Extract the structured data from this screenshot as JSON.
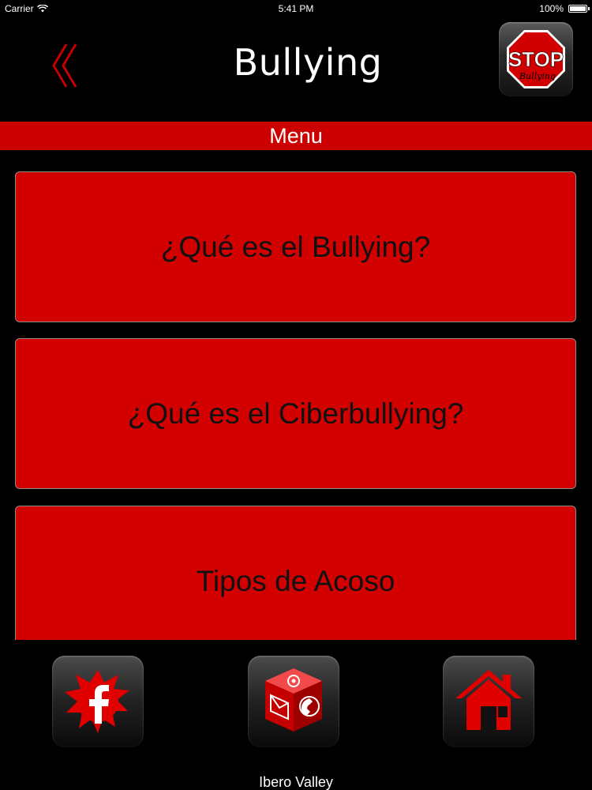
{
  "status_bar": {
    "carrier": "Carrier",
    "time": "5:41 PM",
    "battery": "100%"
  },
  "nav": {
    "title": "Bullying",
    "back_icon": "double-chevron-left-icon",
    "stop_sign": {
      "top_text": "STOP",
      "bottom_text": "Bullying"
    }
  },
  "menu": {
    "header": "Menu",
    "items": [
      {
        "label": "¿Qué es el Bullying?"
      },
      {
        "label": "¿Qué es el Ciberbullying?"
      },
      {
        "label": "Tipos de Acoso"
      }
    ]
  },
  "toolbar": {
    "buttons": [
      {
        "name": "facebook",
        "icon": "facebook-icon"
      },
      {
        "name": "contact",
        "icon": "contact-cube-icon"
      },
      {
        "name": "home",
        "icon": "home-icon"
      }
    ]
  },
  "footer": {
    "text": "Ibero Valley"
  },
  "colors": {
    "accent": "#cc0000",
    "item_bg": "#d30000",
    "background": "#000000"
  }
}
